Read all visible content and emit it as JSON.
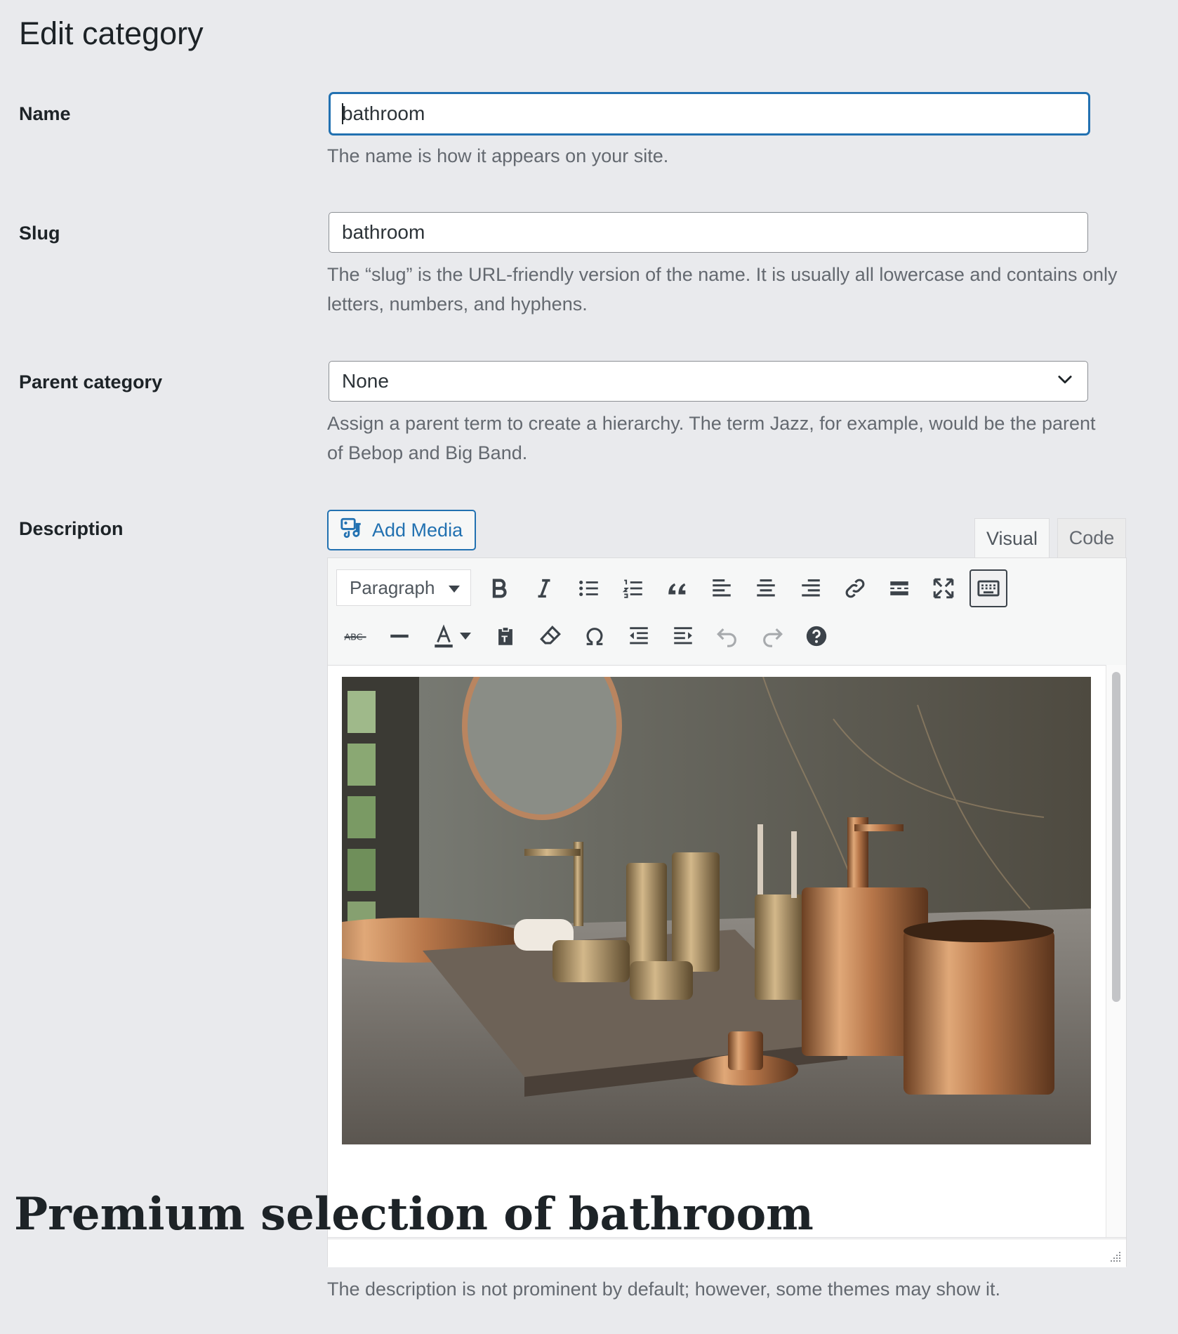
{
  "page": {
    "title": "Edit category"
  },
  "name_field": {
    "label": "Name",
    "value": "bathroom",
    "help": "The name is how it appears on your site."
  },
  "slug_field": {
    "label": "Slug",
    "value": "bathroom",
    "help": "The “slug” is the URL-friendly version of the name. It is usually all lowercase and contains only letters, numbers, and hyphens."
  },
  "parent_field": {
    "label": "Parent category",
    "selected": "None",
    "help": "Assign a parent term to create a hierarchy. The term Jazz, for example, would be the parent of Bebop and Big Band."
  },
  "description_field": {
    "label": "Description",
    "add_media_label": "Add Media",
    "tabs": {
      "visual": "Visual",
      "code": "Code"
    },
    "format_select": "Paragraph",
    "content_heading": "Premium selection of bathroom",
    "help": "The description is not prominent by default; however, some themes may show it."
  },
  "toolbar_icons": [
    "bold-icon",
    "italic-icon",
    "bulleted-list-icon",
    "numbered-list-icon",
    "blockquote-icon",
    "align-left-icon",
    "align-center-icon",
    "align-right-icon",
    "link-icon",
    "read-more-icon",
    "fullscreen-icon",
    "toolbar-toggle-icon",
    "strikethrough-icon",
    "horizontal-line-icon",
    "text-color-icon",
    "paste-text-icon",
    "clear-formatting-icon",
    "special-character-icon",
    "outdent-icon",
    "indent-icon",
    "undo-icon",
    "redo-icon",
    "help-icon"
  ],
  "colors": {
    "accent": "#2271b1",
    "background": "#e9eaed",
    "help_text": "#646970"
  }
}
